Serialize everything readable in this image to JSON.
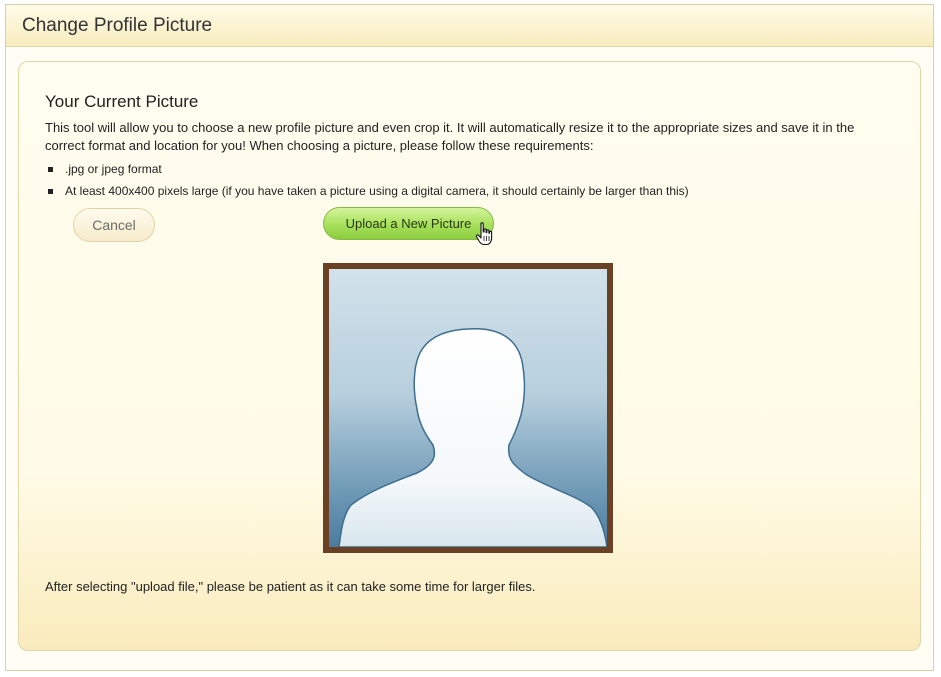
{
  "window": {
    "title": "Change Profile Picture"
  },
  "content": {
    "section_title": "Your Current Picture",
    "description": "This tool will allow you to choose a new profile picture and even crop it. It will automatically resize it to the appropriate sizes and save it in the correct format and location for you! When choosing a picture, please follow these requirements:",
    "requirements": [
      ".jpg or jpeg format",
      "At least 400x400 pixels large (if you have taken a picture using a digital camera, it should certainly be larger than this)"
    ],
    "footnote": "After selecting \"upload file,\" please be patient as it can take some time for larger files."
  },
  "actions": {
    "cancel_label": "Cancel",
    "upload_label": "Upload a New Picture"
  },
  "icons": {
    "cursor": "hand-pointer-icon",
    "avatar": "default-avatar-silhouette"
  },
  "colors": {
    "upload_button": "#a7e05b",
    "frame_border": "#6a4124",
    "panel_background": "#fffbe6"
  }
}
